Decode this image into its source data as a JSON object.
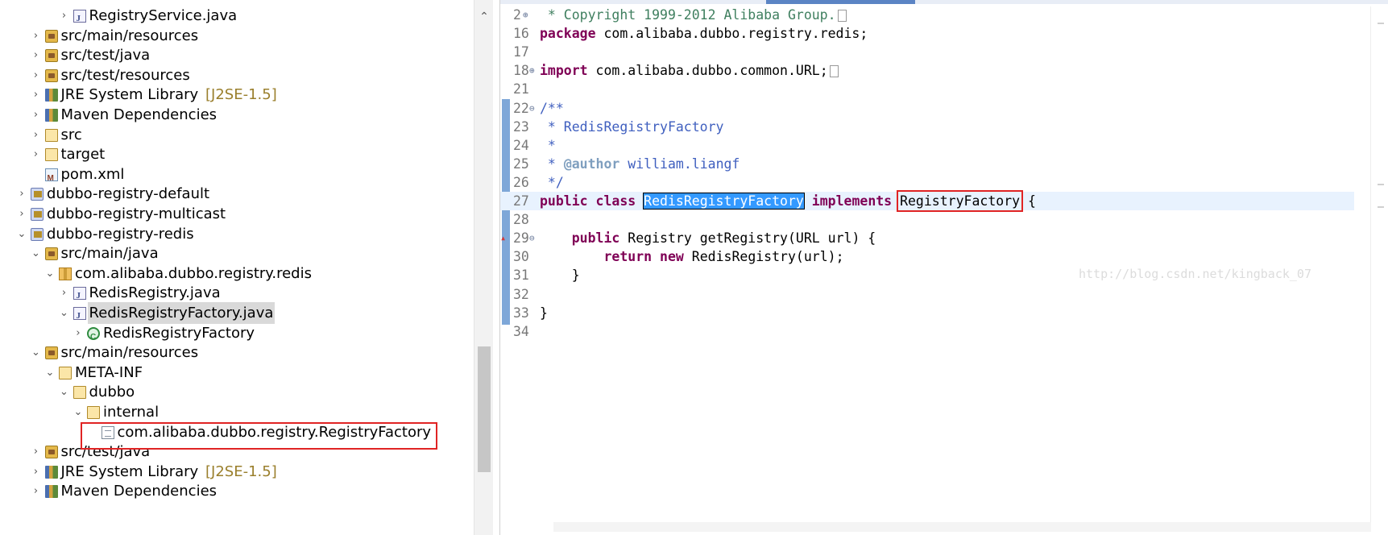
{
  "explorer": {
    "rows": [
      {
        "label": "RegistryService.java",
        "icon": "java-file-icon",
        "toggle": "›",
        "decor": ""
      },
      {
        "label": "src/main/resources",
        "icon": "source-folder-icon",
        "toggle": "›",
        "decor": ""
      },
      {
        "label": "src/test/java",
        "icon": "source-folder-icon",
        "toggle": "›",
        "decor": ""
      },
      {
        "label": "src/test/resources",
        "icon": "source-folder-icon",
        "toggle": "›",
        "decor": ""
      },
      {
        "label": "JRE System Library",
        "icon": "library-icon",
        "toggle": "›",
        "decor": "[J2SE-1.5]"
      },
      {
        "label": "Maven Dependencies",
        "icon": "library-icon",
        "toggle": "›",
        "decor": ""
      },
      {
        "label": "src",
        "icon": "folder-icon",
        "toggle": "›",
        "decor": ""
      },
      {
        "label": "target",
        "icon": "folder-icon",
        "toggle": "›",
        "decor": ""
      },
      {
        "label": "pom.xml",
        "icon": "xml-file-icon",
        "toggle": "",
        "decor": ""
      },
      {
        "label": "dubbo-registry-default",
        "icon": "project-icon",
        "toggle": "›",
        "decor": ""
      },
      {
        "label": "dubbo-registry-multicast",
        "icon": "project-icon",
        "toggle": "›",
        "decor": ""
      },
      {
        "label": "dubbo-registry-redis",
        "icon": "project-icon",
        "toggle": "⌄",
        "decor": ""
      },
      {
        "label": "src/main/java",
        "icon": "source-folder-icon",
        "toggle": "⌄",
        "decor": ""
      },
      {
        "label": "com.alibaba.dubbo.registry.redis",
        "icon": "package-icon",
        "toggle": "⌄",
        "decor": ""
      },
      {
        "label": "RedisRegistry.java",
        "icon": "java-file-icon",
        "toggle": "›",
        "decor": ""
      },
      {
        "label": "RedisRegistryFactory.java",
        "icon": "java-file-icon",
        "toggle": "⌄",
        "decor": ""
      },
      {
        "label": "RedisRegistryFactory",
        "icon": "class-icon",
        "toggle": "›",
        "decor": ""
      },
      {
        "label": "src/main/resources",
        "icon": "source-folder-icon",
        "toggle": "⌄",
        "decor": ""
      },
      {
        "label": "META-INF",
        "icon": "folder-icon",
        "toggle": "⌄",
        "decor": ""
      },
      {
        "label": "dubbo",
        "icon": "folder-icon",
        "toggle": "⌄",
        "decor": ""
      },
      {
        "label": "internal",
        "icon": "folder-icon",
        "toggle": "⌄",
        "decor": ""
      },
      {
        "label": "com.alibaba.dubbo.registry.RegistryFactory",
        "icon": "text-file-icon",
        "toggle": "",
        "decor": ""
      },
      {
        "label": "src/test/java",
        "icon": "source-folder-icon",
        "toggle": "›",
        "decor": ""
      },
      {
        "label": "JRE System Library",
        "icon": "library-icon",
        "toggle": "›",
        "decor": "[J2SE-1.5]"
      },
      {
        "label": "Maven Dependencies",
        "icon": "library-icon",
        "toggle": "›",
        "decor": ""
      }
    ],
    "scroll_up": "⌃"
  },
  "editor": {
    "lines": [
      {
        "num": "2",
        "fold": "⊕",
        "html": [
          [
            "copy",
            " * Copyright 1999-2012 Alibaba Group."
          ],
          [
            "box",
            ""
          ]
        ]
      },
      {
        "num": "16",
        "fold": "",
        "html": [
          [
            "kw",
            "package"
          ],
          [
            "",
            " com.alibaba.dubbo.registry.redis;"
          ]
        ]
      },
      {
        "num": "17",
        "fold": "",
        "html": []
      },
      {
        "num": "18",
        "fold": "⊕",
        "html": [
          [
            "kw",
            "import"
          ],
          [
            "",
            " com.alibaba.dubbo.common.URL;"
          ],
          [
            "box",
            ""
          ]
        ]
      },
      {
        "num": "21",
        "fold": "",
        "html": []
      },
      {
        "num": "22",
        "fold": "⊖",
        "html": [
          [
            "cmt",
            "/**"
          ]
        ]
      },
      {
        "num": "23",
        "fold": "",
        "html": [
          [
            "cmt",
            " * RedisRegistryFactory"
          ]
        ]
      },
      {
        "num": "24",
        "fold": "",
        "html": [
          [
            "cmt",
            " *"
          ]
        ]
      },
      {
        "num": "25",
        "fold": "",
        "html": [
          [
            "cmt",
            " * "
          ],
          [
            "cmttag",
            "@author"
          ],
          [
            "cmt",
            " william.liangf"
          ]
        ]
      },
      {
        "num": "26",
        "fold": "",
        "html": [
          [
            "cmt",
            " */"
          ]
        ]
      },
      {
        "num": "27",
        "fold": "",
        "html": [
          [
            "kw",
            "public"
          ],
          [
            "",
            " "
          ],
          [
            "kw",
            "class"
          ],
          [
            "",
            " "
          ],
          [
            "sel",
            "RedisRegistryFactory"
          ],
          [
            "",
            " "
          ],
          [
            "kw",
            "implements"
          ],
          [
            "",
            " "
          ],
          [
            "boxed",
            "RegistryFactory"
          ],
          [
            "",
            " {"
          ]
        ]
      },
      {
        "num": "28",
        "fold": "",
        "html": []
      },
      {
        "num": "29",
        "fold": "⊖",
        "html": [
          [
            "",
            "    "
          ],
          [
            "kw",
            "public"
          ],
          [
            "",
            " Registry getRegistry(URL url) {"
          ]
        ]
      },
      {
        "num": "30",
        "fold": "",
        "html": [
          [
            "",
            "        "
          ],
          [
            "kw",
            "return"
          ],
          [
            "",
            " "
          ],
          [
            "kw",
            "new"
          ],
          [
            "",
            " RedisRegistry(url);"
          ]
        ]
      },
      {
        "num": "31",
        "fold": "",
        "html": [
          [
            "",
            "    }"
          ]
        ]
      },
      {
        "num": "32",
        "fold": "",
        "html": []
      },
      {
        "num": "33",
        "fold": "",
        "html": [
          [
            "",
            "}"
          ]
        ]
      },
      {
        "num": "34",
        "fold": "",
        "html": []
      }
    ],
    "watermark": "http://blog.csdn.net/kingback_07"
  },
  "colors": {
    "keyword": "#7f0055",
    "comment": "#3f5fbf",
    "selection": "#3399ff",
    "highlight_box": "#e02424"
  }
}
